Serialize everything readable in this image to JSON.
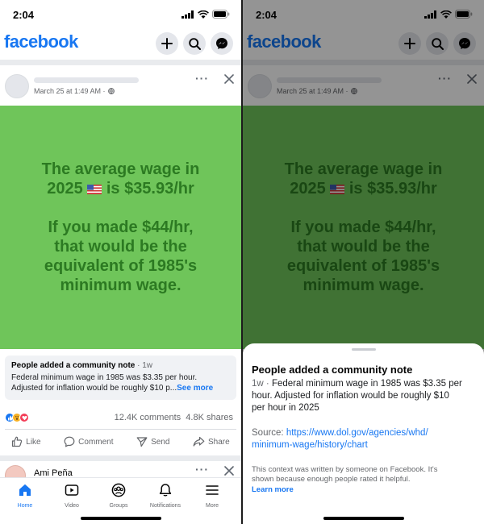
{
  "status_bar": {
    "time": "2:04"
  },
  "app": {
    "logo": "facebook",
    "brand_color": "#1877f2"
  },
  "post": {
    "date": "March 25 at 1:49 AM ·",
    "more_glyph": "···",
    "image_text_line1": "The average wage in",
    "image_text_line2": "2025",
    "image_text_line2b": "is $35.93/hr",
    "image_text_line3": "If you made $44/hr,",
    "image_text_line4": "that would be the",
    "image_text_line5": "equivalent of 1985's",
    "image_text_line6": "minimum wage.",
    "image_bg_color": "#6fc55a",
    "image_text_color": "#2c7a22"
  },
  "community_note": {
    "title": "People added a community note",
    "time": "· 1w",
    "text_line1": "Federal minimum wage in 1985 was $3.35 per hour.",
    "text_line2": "Adjusted for inflation would be roughly $10 p...",
    "see_more": "See more"
  },
  "engagement": {
    "comments": "12.4K comments",
    "shares": "4.8K shares",
    "actions": [
      "Like",
      "Comment",
      "Send",
      "Share"
    ]
  },
  "next_post": {
    "author": "Ami Peña"
  },
  "tabs": [
    {
      "label": "Home",
      "icon": "home-icon",
      "active": true
    },
    {
      "label": "Video",
      "icon": "video-icon",
      "active": false
    },
    {
      "label": "Groups",
      "icon": "groups-icon",
      "active": false
    },
    {
      "label": "Notifications",
      "icon": "bell-icon",
      "active": false
    },
    {
      "label": "More",
      "icon": "menu-icon",
      "active": false
    }
  ],
  "sheet": {
    "title": "People added a community note",
    "time": "1w ·",
    "body_line1": "Federal minimum wage in 1985 was $3.35 per",
    "body_line2": "hour. Adjusted for inflation would be roughly $10",
    "body_line3": "per hour in 2025",
    "source_label": "Source:",
    "source_url_line1": "https://www.dol.gov/agencies/whd/",
    "source_url_line2": "minimum-wage/history/chart",
    "footer_line1": "This context was written by someone on Facebook. It's",
    "footer_line2": "shown because enough people rated it helpful.",
    "learn_more": "Learn more"
  }
}
